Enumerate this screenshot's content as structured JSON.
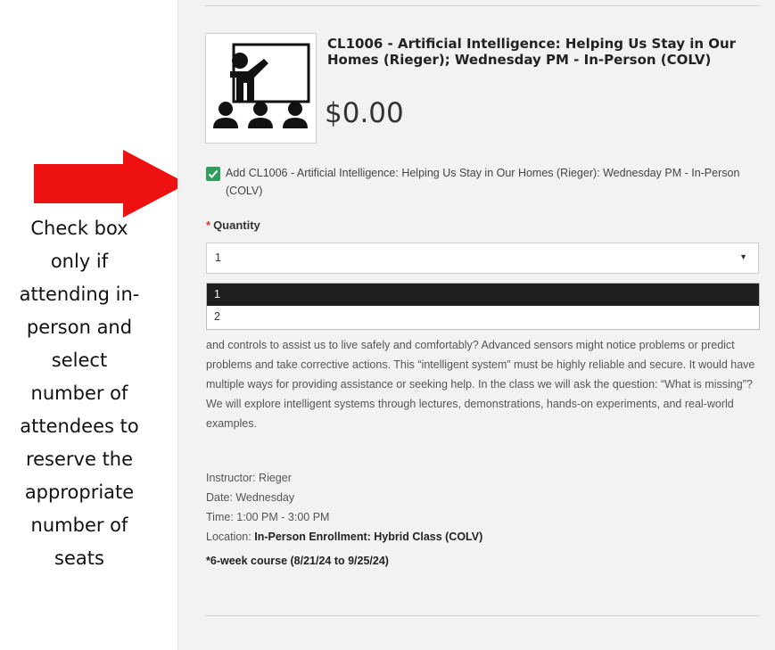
{
  "annotation": {
    "lines": [
      "Check box",
      "only if",
      "attending in-",
      "person and",
      "select",
      "number of",
      "attendees to",
      "reserve the",
      "appropriate",
      "number of",
      "seats"
    ],
    "arrow_color": "#ee1111"
  },
  "product": {
    "thumbnail_icon": "classroom-presentation-icon",
    "title": "CL1006 - Artificial Intelligence: Helping Us Stay in Our Homes (Rieger); Wednesday PM - In-Person (COLV)",
    "price": "$0.00"
  },
  "add_option": {
    "checked": true,
    "label": "Add CL1006 - Artificial Intelligence: Helping Us Stay in Our Homes (Rieger): Wednesday PM - In-Person (COLV)"
  },
  "quantity": {
    "required_marker": "*",
    "label": "Quantity",
    "value": "1",
    "options": [
      "1",
      "2"
    ]
  },
  "description": "and controls to assist us to live safely and comfortably? Advanced sensors might notice problems or predict problems and take corrective actions. This “intelligent system” must be highly reliable and secure. It would have multiple ways for providing assistance or seeking help. In the class we will ask the question: “What is missing”? We will explore intelligent systems through lectures, demonstrations, hands-on experiments, and real-world examples.",
  "details": {
    "instructor": "Instructor: Rieger",
    "date": "Date: Wednesday",
    "time": "Time: 1:00 PM - 3:00 PM",
    "location_label": "Location: ",
    "location_value": "In-Person Enrollment: Hybrid Class (COLV)",
    "course_note": "*6-week course (8/21/24 to 9/25/24)"
  },
  "colors": {
    "checkbox_green": "#2e9e5b",
    "required_red": "#d9342b",
    "selected_option_bg": "#1f1f1f",
    "panel_bg": "#f2f2f2"
  }
}
